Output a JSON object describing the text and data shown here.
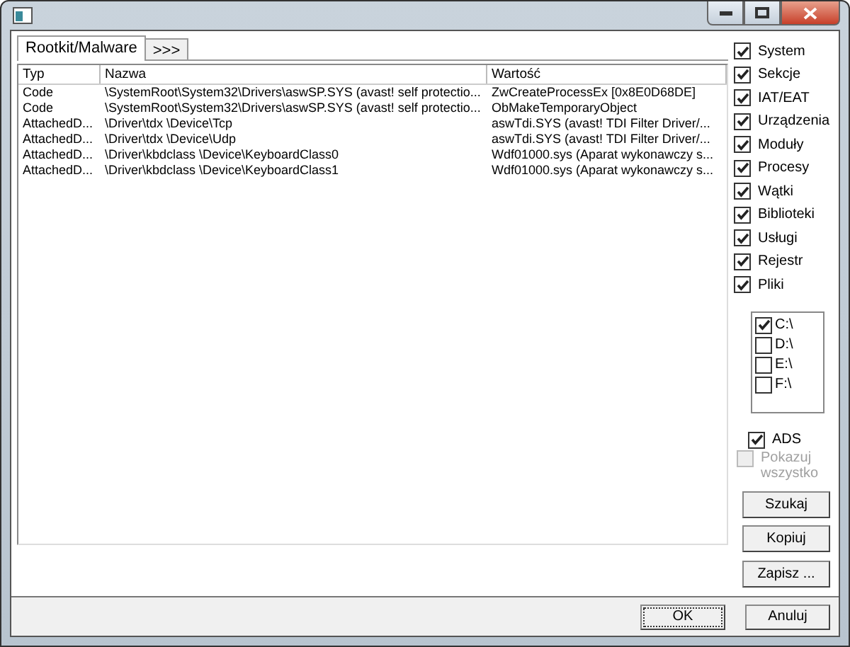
{
  "tabs": [
    {
      "label": "Rootkit/Malware",
      "selected": true
    },
    {
      "label": ">>>",
      "selected": false
    }
  ],
  "table": {
    "columns": [
      "Typ",
      "Nazwa",
      "Wartość"
    ],
    "rows": [
      [
        "Code",
        "\\SystemRoot\\System32\\Drivers\\aswSP.SYS (avast! self protectio...",
        "ZwCreateProcessEx [0x8E0D68DE]"
      ],
      [
        "Code",
        "\\SystemRoot\\System32\\Drivers\\aswSP.SYS (avast! self protectio...",
        "ObMakeTemporaryObject"
      ],
      [
        "AttachedD...",
        "\\Driver\\tdx \\Device\\Tcp",
        "aswTdi.SYS (avast! TDI Filter Driver/..."
      ],
      [
        "AttachedD...",
        "\\Driver\\tdx \\Device\\Udp",
        "aswTdi.SYS (avast! TDI Filter Driver/..."
      ],
      [
        "AttachedD...",
        "\\Driver\\kbdclass \\Device\\KeyboardClass0",
        "Wdf01000.sys (Aparat wykonawczy s..."
      ],
      [
        "AttachedD...",
        "\\Driver\\kbdclass \\Device\\KeyboardClass1",
        "Wdf01000.sys (Aparat wykonawczy s..."
      ]
    ]
  },
  "options": [
    {
      "label": "System",
      "checked": true
    },
    {
      "label": "Sekcje",
      "checked": true
    },
    {
      "label": "IAT/EAT",
      "checked": true
    },
    {
      "label": "Urządzenia",
      "checked": true
    },
    {
      "label": "Moduły",
      "checked": true
    },
    {
      "label": "Procesy",
      "checked": true
    },
    {
      "label": "Wątki",
      "checked": true
    },
    {
      "label": "Biblioteki",
      "checked": true
    },
    {
      "label": "Usługi",
      "checked": true
    },
    {
      "label": "Rejestr",
      "checked": true
    },
    {
      "label": "Pliki",
      "checked": true
    }
  ],
  "drives": [
    {
      "label": "C:\\",
      "checked": true
    },
    {
      "label": "D:\\",
      "checked": false
    },
    {
      "label": "E:\\",
      "checked": false
    },
    {
      "label": "F:\\",
      "checked": false
    }
  ],
  "ads": {
    "label": "ADS",
    "checked": true
  },
  "show_all": {
    "label": "Pokazuj wszystko",
    "checked": false,
    "disabled": true
  },
  "side_buttons": [
    "Szukaj",
    "Kopiuj",
    "Zapisz ..."
  ],
  "buttons": [
    "OK",
    "Anuluj"
  ]
}
